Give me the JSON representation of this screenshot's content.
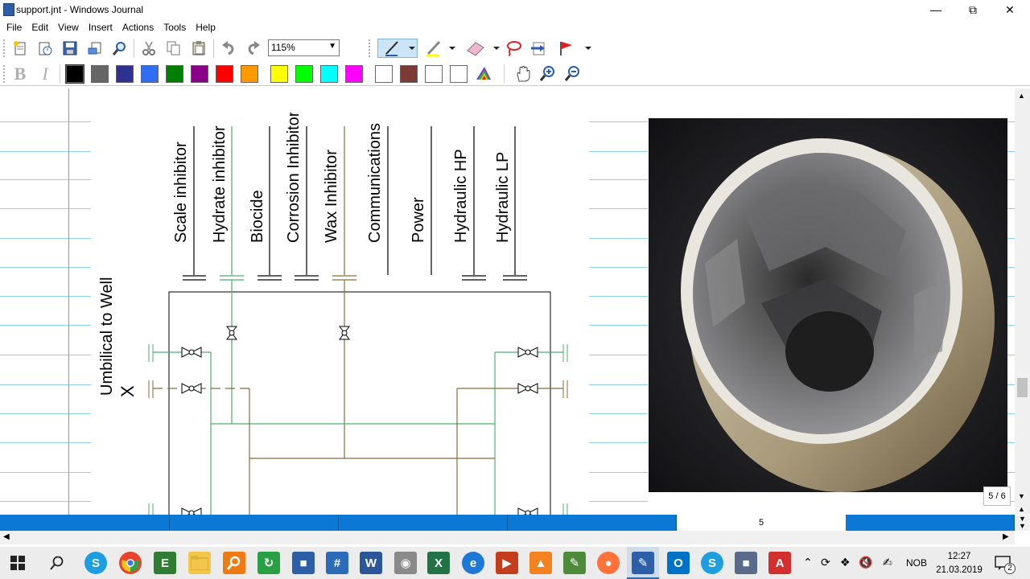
{
  "window": {
    "title": "support.jnt - Windows Journal",
    "minimize": "—",
    "maximize": "⧉",
    "close": "✕"
  },
  "menu": [
    "File",
    "Edit",
    "View",
    "Insert",
    "Actions",
    "Tools",
    "Help"
  ],
  "toolbar": {
    "zoom_value": "115%",
    "bold": "B",
    "italic": "I",
    "colors": [
      "#000000",
      "#666666",
      "#2e3192",
      "#2f6ef2",
      "#008000",
      "#8b008b",
      "#ff0000",
      "#ff9900",
      "#ffff00",
      "#00ff00",
      "#00ffff",
      "#ff00ff",
      "#ffffff",
      "#7b3b34",
      "#ffffff",
      "#ffffff"
    ]
  },
  "diagram": {
    "lines": [
      "Scale inhibitor",
      "Hydrate inhibitor",
      "Biocide",
      "Corrosion Inhibitor",
      "Wax Inhibitor",
      "Communications",
      "Power",
      "Hydraulic HP",
      "Hydraulic LP"
    ],
    "umbilical_label": "Umbilical to Well",
    "x_label": "X"
  },
  "pages": {
    "indicator": "5 / 6",
    "current": "5"
  },
  "taskbar": {
    "language": "NOB",
    "time": "12:27",
    "date": "21.03.2019",
    "notifications": "2"
  }
}
